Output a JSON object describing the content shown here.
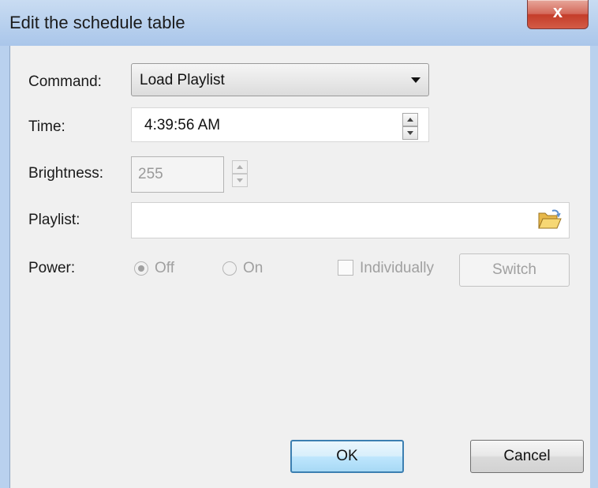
{
  "window": {
    "title": "Edit the schedule table",
    "close_glyph": "x"
  },
  "form": {
    "command": {
      "label": "Command:",
      "value": "Load Playlist"
    },
    "time": {
      "label": "Time:",
      "value": "4:39:56 AM"
    },
    "brightness": {
      "label": "Brightness:",
      "value": "255"
    },
    "playlist": {
      "label": "Playlist:",
      "value": "",
      "browse_icon": "folder-open-icon"
    },
    "power": {
      "label": "Power:",
      "options": [
        {
          "label": "Off",
          "selected": true
        },
        {
          "label": "On",
          "selected": false
        }
      ],
      "individually_label": "Individually",
      "switch_label": "Switch"
    }
  },
  "buttons": {
    "ok": "OK",
    "cancel": "Cancel"
  },
  "colors": {
    "titlebar": "#b9d1ee",
    "close": "#c43d2a",
    "ok_border": "#3c7fb1",
    "disabled_text": "#a0a0a0"
  }
}
